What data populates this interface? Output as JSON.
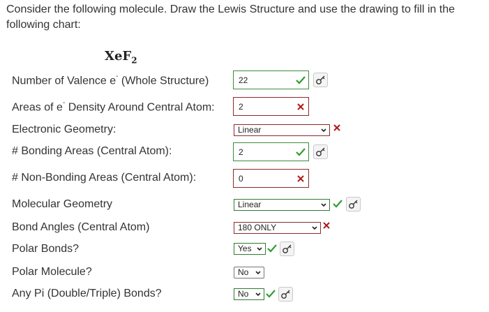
{
  "intro": "Consider the following molecule.  Draw the Lewis Structure and use the drawing to fill in the following chart:",
  "molecule": {
    "base": "XeF",
    "subscript": "2"
  },
  "icons": {
    "correct": "check-icon",
    "incorrect": "x-icon",
    "answer": "key-icon",
    "dropdown": "chevron-down-icon"
  },
  "colors": {
    "correct": "#2e9e2e",
    "incorrect": "#b01818"
  },
  "rows": [
    {
      "label_pre": "Number of Valence e",
      "label_sup": "-",
      "label_post": " (Whole Structure)",
      "value": "22",
      "status": "correct"
    },
    {
      "label_pre": "Areas of e",
      "label_sup": "-",
      "label_post": " Density Around Central Atom:",
      "value": "2",
      "status": "incorrect"
    },
    {
      "label": "Electronic Geometry:",
      "value": "Linear",
      "status": "incorrect"
    },
    {
      "label": "# Bonding Areas (Central Atom):",
      "value": "2",
      "status": "correct"
    },
    {
      "label": "# Non-Bonding Areas (Central Atom):",
      "value": "0",
      "status": "incorrect"
    },
    {
      "label": "Molecular Geometry",
      "value": "Linear",
      "status": "correct"
    },
    {
      "label": "Bond Angles (Central Atom)",
      "value": "180 ONLY",
      "status": "incorrect"
    },
    {
      "label": "Polar Bonds?",
      "value": "Yes",
      "status": "correct"
    },
    {
      "label": "Polar Molecule?",
      "value": "No",
      "status": "unanswered"
    },
    {
      "label": "Any Pi (Double/Triple) Bonds?",
      "value": "No",
      "status": "correct"
    }
  ]
}
